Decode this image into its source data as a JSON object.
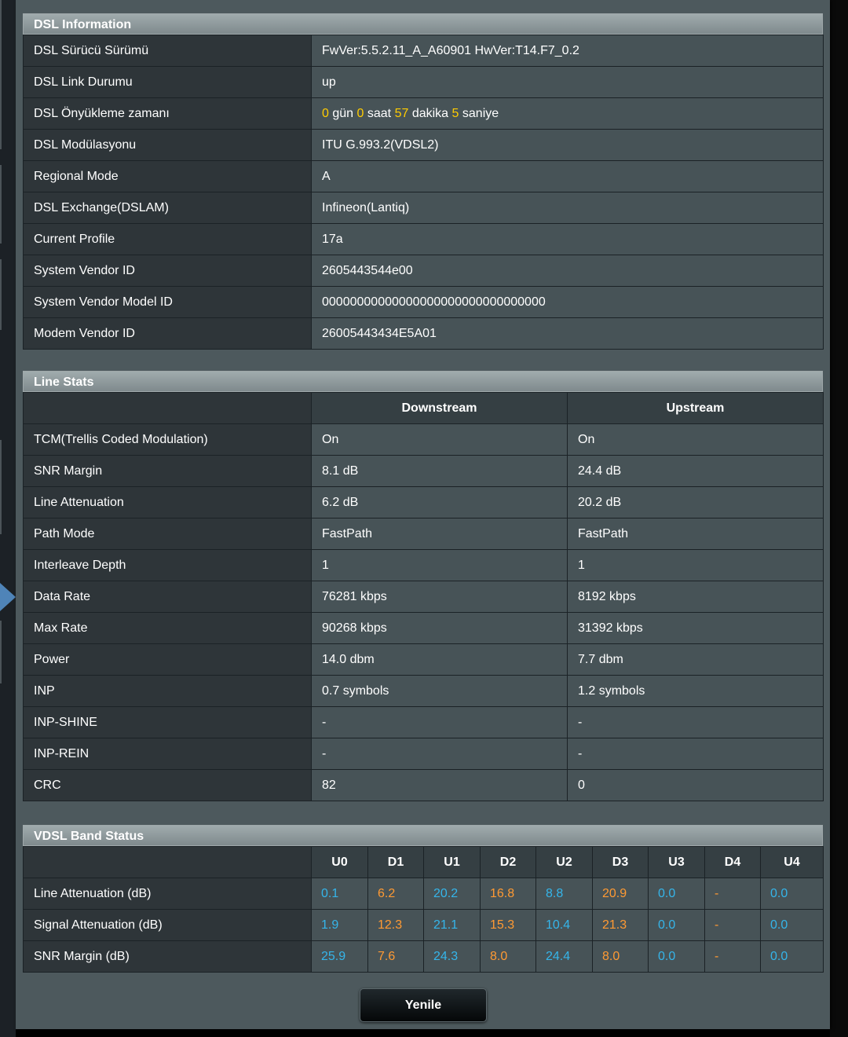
{
  "dsl_info": {
    "title": "DSL Information",
    "driver_version_label": "DSL Sürücü Sürümü",
    "driver_version_value": "FwVer:5.5.2.11_A_A60901 HwVer:T14.F7_0.2",
    "link_status_label": "DSL Link Durumu",
    "link_status_value": "up",
    "uptime_label": "DSL Önyükleme zamanı",
    "uptime": {
      "days": "0",
      "days_unit": "gün",
      "hours": "0",
      "hours_unit": "saat",
      "minutes": "57",
      "minutes_unit": "dakika",
      "seconds": "5",
      "seconds_unit": "saniye"
    },
    "modulation_label": "DSL Modülasyonu",
    "modulation_value": "ITU G.993.2(VDSL2)",
    "regional_mode_label": "Regional Mode",
    "regional_mode_value": "A",
    "exchange_label": "DSL Exchange(DSLAM)",
    "exchange_value": "Infineon(Lantiq)",
    "profile_label": "Current Profile",
    "profile_value": "17a",
    "vendor_id_label": "System Vendor ID",
    "vendor_id_value": "2605443544e00",
    "vendor_model_label": "System Vendor Model ID",
    "vendor_model_value": "00000000000000000000000000000000",
    "modem_vendor_label": "Modem Vendor ID",
    "modem_vendor_value": "26005443434E5A01"
  },
  "line_stats": {
    "title": "Line Stats",
    "col_downstream": "Downstream",
    "col_upstream": "Upstream",
    "rows": [
      {
        "label": "TCM(Trellis Coded Modulation)",
        "down": "On",
        "up": "On"
      },
      {
        "label": "SNR Margin",
        "down": "8.1 dB",
        "up": "24.4 dB"
      },
      {
        "label": "Line Attenuation",
        "down": "6.2 dB",
        "up": "20.2 dB"
      },
      {
        "label": "Path Mode",
        "down": "FastPath",
        "up": "FastPath"
      },
      {
        "label": "Interleave Depth",
        "down": "1",
        "up": "1"
      },
      {
        "label": "Data Rate",
        "down": "76281 kbps",
        "up": "8192 kbps"
      },
      {
        "label": "Max Rate",
        "down": "90268 kbps",
        "up": "31392 kbps"
      },
      {
        "label": "Power",
        "down": "14.0 dbm",
        "up": "7.7 dbm"
      },
      {
        "label": "INP",
        "down": "0.7 symbols",
        "up": "1.2 symbols"
      },
      {
        "label": "INP-SHINE",
        "down": "-",
        "up": "-"
      },
      {
        "label": "INP-REIN",
        "down": "-",
        "up": "-"
      },
      {
        "label": "CRC",
        "down": "82",
        "up": "0"
      }
    ]
  },
  "vdsl_band": {
    "title": "VDSL Band Status",
    "bands": [
      "U0",
      "D1",
      "U1",
      "D2",
      "U2",
      "D3",
      "U3",
      "D4",
      "U4"
    ],
    "rows": [
      {
        "label": "Line Attenuation (dB)",
        "values": [
          "0.1",
          "6.2",
          "20.2",
          "16.8",
          "8.8",
          "20.9",
          "0.0",
          "-",
          "0.0"
        ]
      },
      {
        "label": "Signal Attenuation (dB)",
        "values": [
          "1.9",
          "12.3",
          "21.1",
          "15.3",
          "10.4",
          "21.3",
          "0.0",
          "-",
          "0.0"
        ]
      },
      {
        "label": "SNR Margin (dB)",
        "values": [
          "25.9",
          "7.6",
          "24.3",
          "8.0",
          "24.4",
          "8.0",
          "0.0",
          "-",
          "0.0"
        ]
      }
    ],
    "upstream_color": "#35b5ea",
    "downstream_color": "#ff9a33"
  },
  "refresh_button": "Yenile",
  "colors": {
    "panel_bg": "#4d595d",
    "label_cell": "#2e3539",
    "value_cell": "#475357",
    "highlight_yellow": "#ffcc00"
  }
}
